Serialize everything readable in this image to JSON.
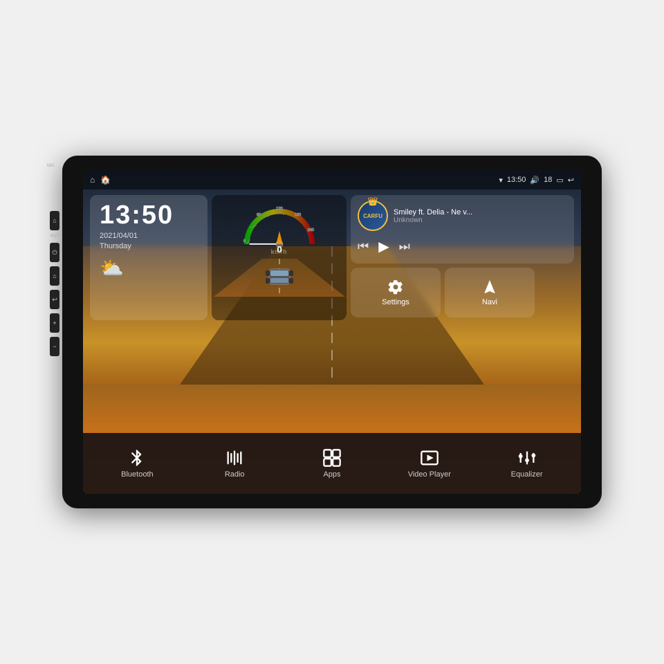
{
  "device": {
    "mic_label": "MIC",
    "rst_label": "RST"
  },
  "status_bar": {
    "home_icon": "⌂",
    "android_icon": "🏠",
    "wifi_icon": "▾",
    "time": "13:50",
    "volume_icon": "🔊",
    "volume_level": "18",
    "battery_icon": "▭",
    "back_icon": "↩"
  },
  "clock": {
    "time": "13:50",
    "date": "2021/04/01",
    "day": "Thursday"
  },
  "weather": {
    "icon": "⛅"
  },
  "speedometer": {
    "value": "0",
    "unit": "km/h",
    "max": "240"
  },
  "music": {
    "logo_text": "CARFU",
    "title": "Smiley ft. Delia - Ne v...",
    "artist": "Unknown",
    "prev_icon": "⏮",
    "play_icon": "▶",
    "next_icon": "⏭"
  },
  "quick_actions": [
    {
      "id": "settings",
      "icon": "⚙",
      "label": "Settings"
    },
    {
      "id": "navi",
      "icon": "◬",
      "label": "Navi"
    }
  ],
  "bottom_bar": [
    {
      "id": "bluetooth",
      "icon": "bluetooth",
      "label": "Bluetooth"
    },
    {
      "id": "radio",
      "icon": "radio",
      "label": "Radio"
    },
    {
      "id": "apps",
      "icon": "apps",
      "label": "Apps"
    },
    {
      "id": "video",
      "icon": "video",
      "label": "Video Player"
    },
    {
      "id": "equalizer",
      "icon": "equalizer",
      "label": "Equalizer"
    }
  ],
  "side_buttons": [
    {
      "icon": "⌂",
      "label": "home"
    },
    {
      "icon": "⏻",
      "label": "power"
    },
    {
      "icon": "⌂",
      "label": "home2"
    },
    {
      "icon": "↩",
      "label": "back"
    },
    {
      "icon": "➕",
      "label": "vol-up"
    },
    {
      "icon": "➖",
      "label": "vol-down"
    }
  ]
}
